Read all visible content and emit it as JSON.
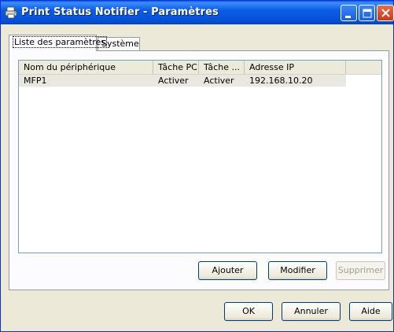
{
  "window": {
    "title": "Print Status Notifier - Paramètres",
    "icon": "printer-icon"
  },
  "tabs": [
    {
      "label": "Liste des paramètres",
      "active": true
    },
    {
      "label": "Système",
      "active": false
    }
  ],
  "list": {
    "columns": [
      "Nom du périphérique",
      "Tâche PC",
      "Tâche ...",
      "Adresse IP"
    ],
    "rows": [
      {
        "device": "MFP1",
        "pc_task": "Activer",
        "task": "Activer",
        "ip": "192.168.10.20"
      }
    ]
  },
  "panel_buttons": {
    "add": "Ajouter",
    "modify": "Modifier",
    "delete": "Supprimer"
  },
  "dialog_buttons": {
    "ok": "OK",
    "cancel": "Annuler",
    "help": "Aide"
  }
}
